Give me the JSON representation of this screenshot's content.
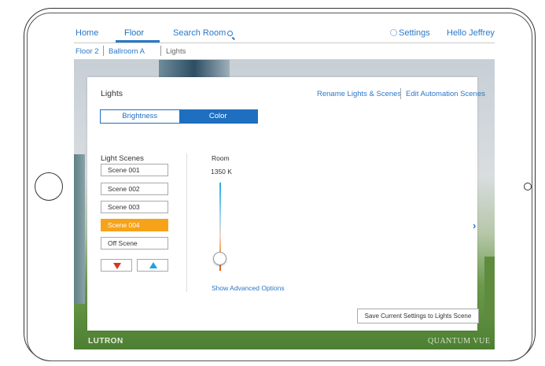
{
  "nav": {
    "home": "Home",
    "floor": "Floor",
    "search_room": "Search Room",
    "settings": "Settings",
    "greeting": "Hello Jeffrey"
  },
  "breadcrumb": [
    "Floor 2",
    "Ballroom A",
    "Lights"
  ],
  "panel": {
    "title": "Lights",
    "rename_link": "Rename Lights & Scenes",
    "automation_link": "Edit Automation Scenes",
    "tabs": [
      "Brightness",
      "Color"
    ],
    "active_tab": "Color"
  },
  "scenes": {
    "heading": "Light Scenes",
    "items": [
      "Scene 001",
      "Scene 002",
      "Scene 003",
      "Scene 004",
      "Off Scene"
    ],
    "active": "Scene 004"
  },
  "room": {
    "label": "Room",
    "temperature": "1350 K"
  },
  "links": {
    "advanced": "Show Advanced Options"
  },
  "save_button": "Save Current Settings to Lights Scene",
  "brand": {
    "left": "LUTRON",
    "right": "QUANTUM VUE"
  },
  "colors": {
    "accent": "#2a78c8",
    "active_scene": "#f6a31a",
    "down_arrow": "#e0301e",
    "up_arrow": "#1aa3e0"
  }
}
